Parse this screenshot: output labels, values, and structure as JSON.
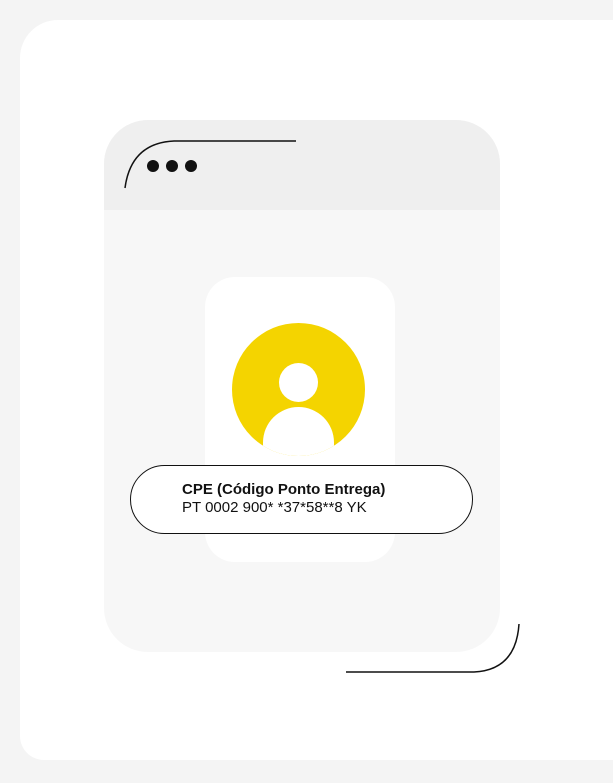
{
  "window": {
    "dots_icon": "ellipsis-icon",
    "accent_color": "#f4d400"
  },
  "profile": {
    "avatar_icon": "user-avatar-icon"
  },
  "cpe": {
    "title": "CPE (Código Ponto Entrega)",
    "value": "PT 0002 900* *37*58**8 YK"
  }
}
